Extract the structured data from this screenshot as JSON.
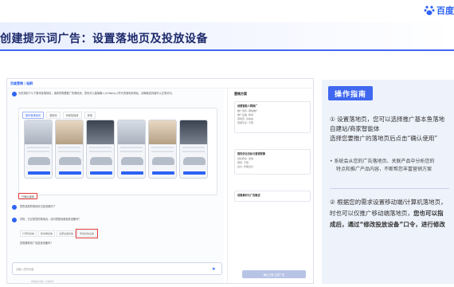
{
  "brand": {
    "logo_text": "百度"
  },
  "title": "创建提示词广告：设置落地页及投放设备",
  "screenshot": {
    "top_bar": {
      "brand": "百度营销 | 轻舸"
    },
    "chat": {
      "intro": "为您找到了以下基本鱼落地页，选择您需要推广的落地页，您也可以直接输入以http(s)://开头的落地页网址，请确保该页面可以正常访问。",
      "tabs": [
        "基本鱼落地页",
        "营销页",
        "商家智能体",
        "其他"
      ],
      "use_button": "已确认使用",
      "selected_msg": "您所选择的落地页已经设置好了",
      "device_msg": "好的，已记录您的落地页。请问您想设置投放设备吗？",
      "chips": [
        "计算机投放",
        "移动端投放",
        "全部设备投放",
        "修改投放设备"
      ],
      "chip_selected": "修改投放设备",
      "followup": "您需要修改广告投放设备吗？",
      "input_placeholder": "请输入您的问题",
      "footer": "内容由AI生成，仅供参考"
    },
    "panel": {
      "title": "营销方案",
      "box1_title": "创意智能人群推广",
      "box1_rows": [
        "推广目标: 网站推广",
        "推广设备: 移动",
        "落地页: 基本鱼",
        "营销节点: 不限"
      ],
      "box2_title": "我的优化目标与营销预算",
      "box2_rows": [
        "目标转化: 咨询",
        "预算: 不限",
        "出价: 智能出价"
      ],
      "box3_title": "创意素材与广告概述",
      "gen_button": "确认方案 生成广告"
    }
  },
  "guide": {
    "badge": "操作指南",
    "step1_lines": [
      "① 设置落地页，您可以选择推广基本鱼落地",
      "自建站/商家智能体",
      "选择您要推广的落地页后点击“确认使用”"
    ],
    "bullet_lines": [
      "• 系统会从您的广告落地页、关联产品中分析您的",
      "特点和推广产品内容，不断帮您丰富营销方案"
    ],
    "step2_lines": [
      "② 根据您的需求设置移动端/计算机落地页，",
      "时也可以仅推广移动端落地页，"
    ],
    "step2_bold_inline": "您也可以指",
    "step2_bold_line": "成后，通过“修改投放设备”口令，进行修改"
  },
  "colors": {
    "accent": "#3f67f0",
    "title": "#1d2a6b",
    "highlight": "#e23a3a"
  }
}
